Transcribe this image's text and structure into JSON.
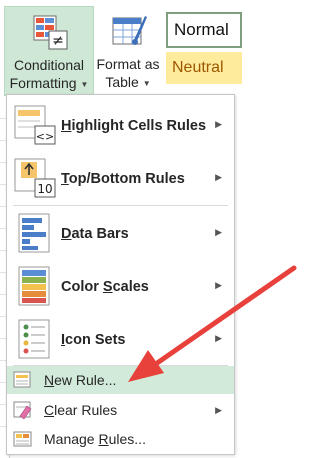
{
  "ribbon": {
    "conditional_formatting": {
      "line1": "Conditional",
      "line2": "Formatting",
      "icon": "conditional-formatting-icon"
    },
    "format_as_table": {
      "line1": "Format as",
      "line2": "Table",
      "icon": "format-as-table-icon"
    },
    "cell_styles": [
      {
        "label": "Normal",
        "fill": "#ffffff",
        "text_color": "#111111"
      },
      {
        "label": "Neutral",
        "fill": "#ffeb9c",
        "text_color": "#9c5700"
      }
    ]
  },
  "menu": {
    "items": [
      {
        "pre": "",
        "key": "H",
        "post": "ighlight Cells Rules",
        "icon": "highlight-cells-rules-icon",
        "submenu": true
      },
      {
        "pre": "",
        "key": "T",
        "post": "op/Bottom Rules",
        "icon": "top-bottom-rules-icon",
        "submenu": true
      },
      {
        "pre": "",
        "key": "D",
        "post": "ata Bars",
        "icon": "data-bars-icon",
        "submenu": true
      },
      {
        "pre": "Color ",
        "key": "S",
        "post": "cales",
        "icon": "color-scales-icon",
        "submenu": true
      },
      {
        "pre": "",
        "key": "I",
        "post": "con Sets",
        "icon": "icon-sets-icon",
        "submenu": true
      },
      {
        "pre": "",
        "key": "N",
        "post": "ew Rule...",
        "icon": "new-rule-icon",
        "submenu": false,
        "highlighted": true
      },
      {
        "pre": "",
        "key": "C",
        "post": "lear Rules",
        "icon": "clear-rules-icon",
        "submenu": true
      },
      {
        "pre": "Manage ",
        "key": "R",
        "post": "ules...",
        "icon": "manage-rules-icon",
        "submenu": false
      }
    ]
  },
  "colors": {
    "selected_button": "#cfe8d5",
    "menu_highlight": "#d2eada",
    "annotation_arrow": "#e8403a"
  }
}
